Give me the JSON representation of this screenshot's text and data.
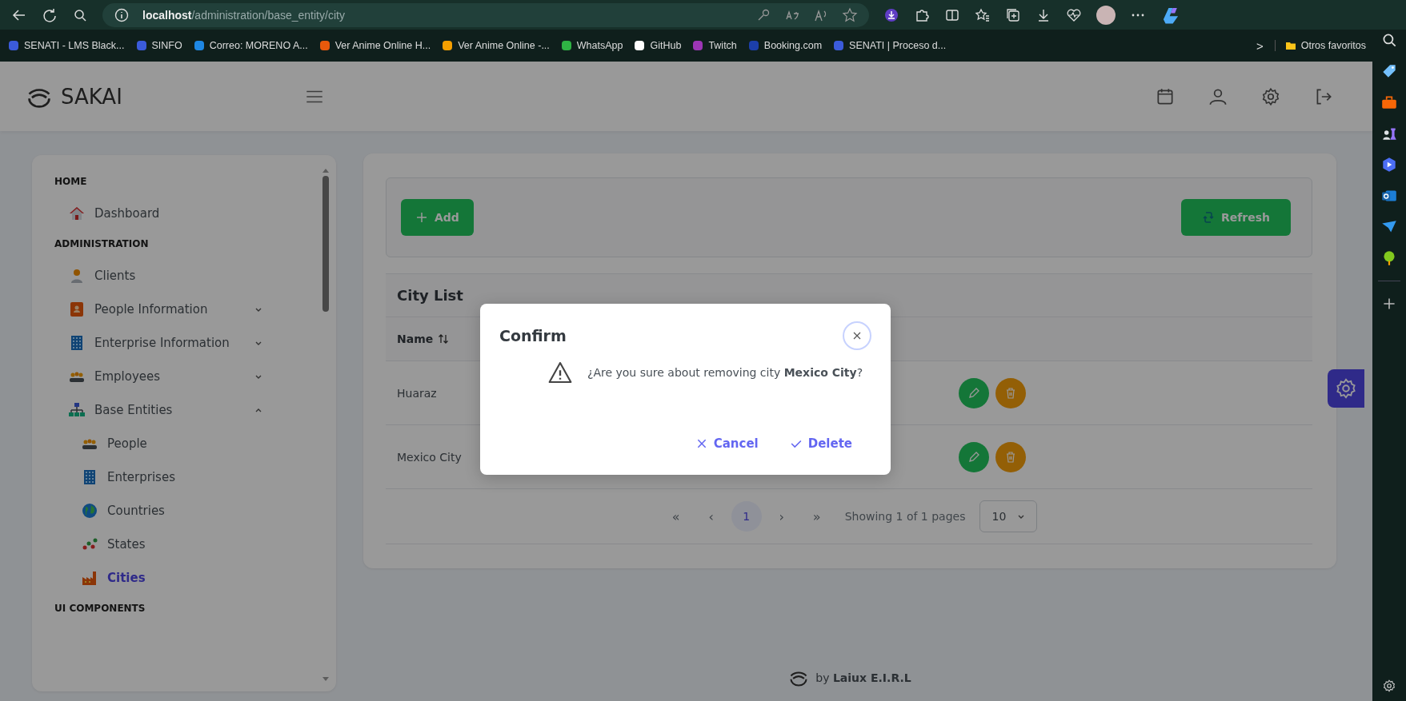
{
  "browser": {
    "url_host": "localhost",
    "url_path": "/administration/base_entity/city",
    "bookmarks": [
      "SENATI - LMS Black...",
      "SINFO",
      "Correo: MORENO A...",
      "Ver Anime Online H...",
      "Ver Anime Online -...",
      "WhatsApp",
      "GitHub",
      "Twitch",
      "Booking.com",
      "SENATI | Proceso d..."
    ],
    "more_bookmarks": ">",
    "other_bookmarks": "Otros favoritos"
  },
  "app": {
    "logo": "SAKAI",
    "sidebar": {
      "sections": [
        {
          "title": "HOME",
          "items": [
            {
              "label": "Dashboard",
              "selected": false
            }
          ]
        },
        {
          "title": "ADMINISTRATION",
          "items": [
            {
              "label": "Clients",
              "selected": false
            },
            {
              "label": "People Information",
              "selected": false,
              "expanded": false
            },
            {
              "label": "Enterprise Information",
              "selected": false,
              "expanded": false
            },
            {
              "label": "Employees",
              "selected": false,
              "expanded": false
            },
            {
              "label": "Base Entities",
              "selected": false,
              "expanded": true,
              "children": [
                {
                  "label": "People",
                  "selected": false
                },
                {
                  "label": "Enterprises",
                  "selected": false
                },
                {
                  "label": "Countries",
                  "selected": false
                },
                {
                  "label": "States",
                  "selected": false
                },
                {
                  "label": "Cities",
                  "selected": true
                }
              ]
            }
          ]
        },
        {
          "title": "UI COMPONENTS"
        }
      ]
    },
    "toolbar": {
      "add": "Add",
      "refresh": "Refresh"
    },
    "table": {
      "title": "City List",
      "columns": [
        {
          "label": "Name"
        }
      ],
      "rows": [
        {
          "name": "Huaraz"
        },
        {
          "name": "Mexico City"
        }
      ]
    },
    "paginator": {
      "first": "«",
      "prev": "‹",
      "pages": [
        {
          "label": "1",
          "selected": true
        }
      ],
      "next": "›",
      "last": "»",
      "report": "Showing 1 of 1 pages",
      "rows_per_page": "10"
    },
    "footer": "by **Laiux E.I.R.L**",
    "dialog": {
      "title": "Confirm",
      "message": "¿Are you sure about removing city **Mexico City**?",
      "cancel": "Cancel",
      "accept": "Delete"
    }
  }
}
